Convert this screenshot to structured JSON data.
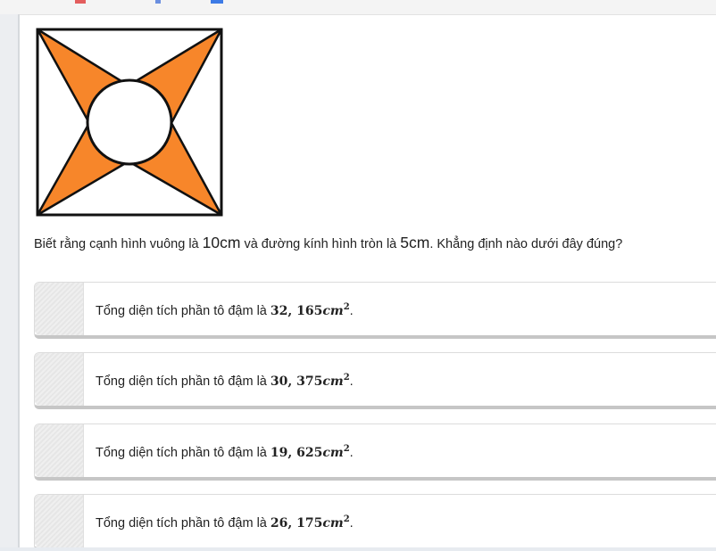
{
  "question": {
    "part1": "Biết rằng cạnh hình vuông là ",
    "side": "10cm",
    "part2": " và đường kính hình tròn là ",
    "diameter": "5cm",
    "part3": ". Khẳng định nào dưới đây đúng?"
  },
  "options": [
    {
      "prefix": "Tổng diện tích phần tô đậm là ",
      "value": "32, 165",
      "unit": "cm",
      "power": "2",
      "suffix": "."
    },
    {
      "prefix": "Tổng diện tích phần tô đậm là ",
      "value": "30, 375",
      "unit": "cm",
      "power": "2",
      "suffix": "."
    },
    {
      "prefix": "Tổng diện tích phần tô đậm là ",
      "value": "19, 625",
      "unit": "cm",
      "power": "2",
      "suffix": "."
    },
    {
      "prefix": "Tổng diện tích phần tô đậm là ",
      "value": "26, 175",
      "unit": "cm",
      "power": "2",
      "suffix": "."
    }
  ],
  "colors": {
    "shaded": "#f7862a",
    "outline": "#111111"
  }
}
